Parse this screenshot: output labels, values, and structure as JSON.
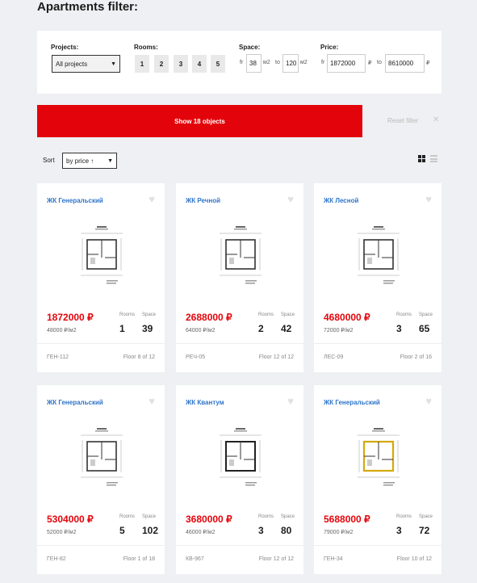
{
  "title": "Apartments filter:",
  "filters": {
    "projects_label": "Projects:",
    "projects_value": "All projects",
    "rooms_label": "Rooms:",
    "rooms": [
      "1",
      "2",
      "3",
      "4",
      "5"
    ],
    "space_label": "Space:",
    "space_from_prefix": "fr",
    "space_from": "38",
    "space_unit": "м2",
    "space_to_prefix": "to",
    "space_to": "120",
    "price_label": "Price:",
    "price_from_prefix": "fr",
    "price_from": "1872000",
    "price_unit": "₽",
    "price_to_prefix": "to",
    "price_to": "8610000"
  },
  "actions": {
    "show_label": "Show 18 objects",
    "reset_label": "Reset filter",
    "reset_icon": "close-icon"
  },
  "sort": {
    "label": "Sort",
    "value": "by price ↑"
  },
  "view_icons": [
    "grid-view-icon",
    "list-view-icon"
  ],
  "colors": {
    "accent": "#e3040b",
    "link": "#2e74c9",
    "background": "#eef0f3"
  },
  "cards": [
    {
      "project": "ЖК Генеральский",
      "price": "1872000 ₽",
      "price_per_m2": "48000 ₽/м2",
      "rooms_label": "Rooms",
      "rooms": "1",
      "space_label": "Space",
      "space": "39",
      "code": "ГЕН-112",
      "floor": "Floor 8 of 12"
    },
    {
      "project": "ЖК Речной",
      "price": "2688000 ₽",
      "price_per_m2": "64000 ₽/м2",
      "rooms_label": "Rooms",
      "rooms": "2",
      "space_label": "Space",
      "space": "42",
      "code": "РЕЧ-05",
      "floor": "Floor 12 of 12"
    },
    {
      "project": "ЖК Лесной",
      "price": "4680000 ₽",
      "price_per_m2": "72000 ₽/м2",
      "rooms_label": "Rooms",
      "rooms": "3",
      "space_label": "Space",
      "space": "65",
      "code": "ЛЕС-09",
      "floor": "Floor 2 of 16"
    },
    {
      "project": "ЖК Генеральский",
      "price": "5304000 ₽",
      "price_per_m2": "52000 ₽/м2",
      "rooms_label": "Rooms",
      "rooms": "5",
      "space_label": "Space",
      "space": "102",
      "code": "ГЕН-82",
      "floor": "Floor 1 of 18"
    },
    {
      "project": "ЖК Квантум",
      "price": "3680000 ₽",
      "price_per_m2": "46000 ₽/м2",
      "rooms_label": "Rooms",
      "rooms": "3",
      "space_label": "Space",
      "space": "80",
      "code": "КВ-967",
      "floor": "Floor 12 of 12"
    },
    {
      "project": "ЖК Генеральский",
      "price": "5688000 ₽",
      "price_per_m2": "79000 ₽/м2",
      "rooms_label": "Rooms",
      "rooms": "3",
      "space_label": "Space",
      "space": "72",
      "code": "ГЕН-34",
      "floor": "Floor 10 of 12"
    }
  ]
}
